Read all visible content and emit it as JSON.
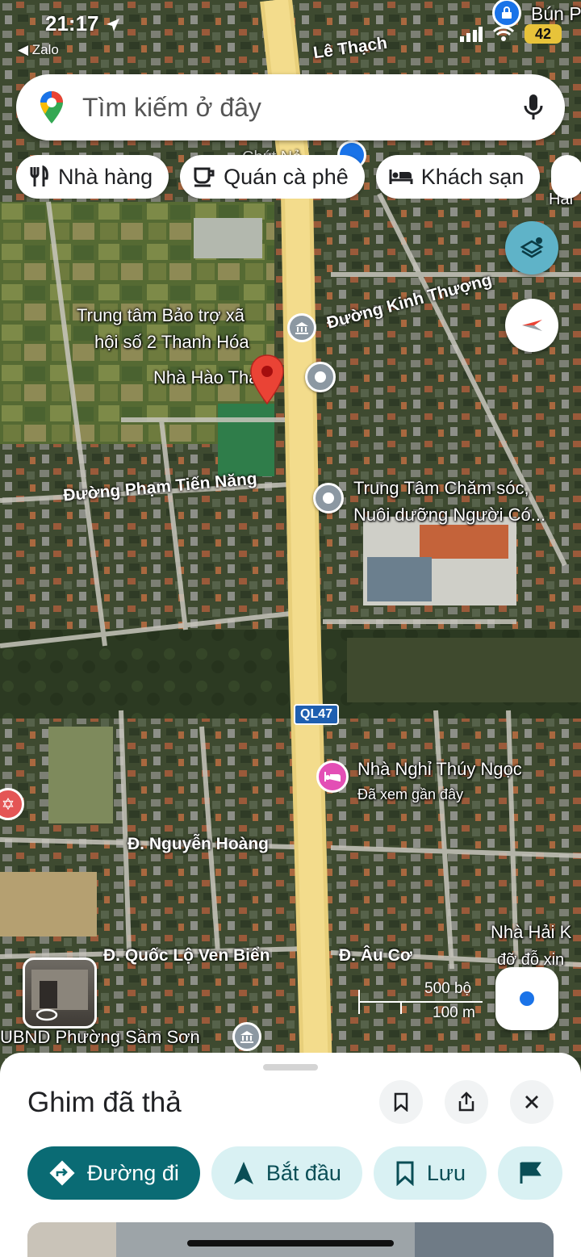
{
  "status_bar": {
    "time": "21:17",
    "back_app": "◀ Zalo",
    "battery": "42"
  },
  "search": {
    "placeholder": "Tìm kiếm ở đây"
  },
  "chips": [
    {
      "label": "Nhà hàng",
      "icon": "restaurant-icon"
    },
    {
      "label": "Quán cà phê",
      "icon": "coffee-icon"
    },
    {
      "label": "Khách sạn",
      "icon": "hotel-icon"
    }
  ],
  "map": {
    "road_labels": {
      "le_thach": "Lê Thạch",
      "kinh_thuong": "Đường Kinh Thượng",
      "pham_tien_nang": "Đường Phạm Tiến Năng",
      "ql47": "QL47",
      "nguyen_hoang": "Đ. Nguyễn Hoàng",
      "quoc_lo_ven_bien": "Đ. Quốc Lộ Ven Biển",
      "au_co": "Đ. Âu Cơ"
    },
    "places": {
      "bun": "Bún P",
      "bao_tro_line1": "Trung tâm Bảo trợ xã",
      "bao_tro_line2": "hội số 2 Thanh Hóa",
      "nha_hao": "Nhà Hào Thắng",
      "cham_soc_line1": "Trung Tâm Chăm sóc,",
      "cham_soc_line2": "Nuôi dưỡng Người Có...",
      "nha_nghi": "Nhà Nghỉ Thúy Ngọc",
      "nha_nghi_sub": "Đã xem gần đây",
      "nha_hai_line1": "Nhà Hải K",
      "nha_hai_line2": "đỡ đỗ xin",
      "ubnd": "UBND Phường Sầm Sơn",
      "hai": "Hải",
      "chut": "Chút Nẻ"
    },
    "scale": {
      "imperial": "500 bộ",
      "metric": "100 m"
    }
  },
  "sheet": {
    "title": "Ghim đã thả",
    "actions": [
      {
        "label": "Đường đi",
        "icon": "directions-icon"
      },
      {
        "label": "Bắt đầu",
        "icon": "navigation-arrow-icon"
      },
      {
        "label": "Lưu",
        "icon": "bookmark-icon"
      }
    ]
  },
  "colors": {
    "accent": "#0a6b74",
    "accent_light": "#d9f1f3",
    "pin": "#ea4335",
    "hotel_poi": "#e34fb5",
    "road": "#f3dc8c"
  }
}
